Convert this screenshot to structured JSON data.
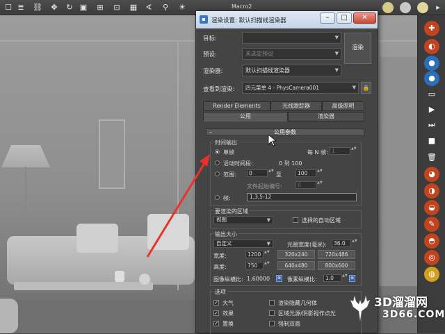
{
  "toolbar": {
    "macro_label": "Macro2"
  },
  "dialog": {
    "title": "渲染设置: 默认扫描线渲染器",
    "target_label": "目标:",
    "target_value": "",
    "preset_label": "预设:",
    "preset_value": "未选定预设",
    "renderer_label": "渲染器:",
    "renderer_value": "默认扫描线渲染器",
    "view_label": "查看到渲染:",
    "view_value": "四元菜单 4 - PhysCamera001",
    "render_button": "渲染",
    "tabs_top": [
      "Render Elements",
      "光线跟踪器",
      "高级照明"
    ],
    "tabs_bottom": [
      "公用",
      "渲染器"
    ],
    "rollout_title": "公用参数",
    "time_output": {
      "title": "时间输出",
      "single": "单帧",
      "every_n_label": "每 N 帧:",
      "every_n_value": "1",
      "active_segment": "活动时间段:",
      "active_range": "0 到 100",
      "range_label": "范围:",
      "range_from": "0",
      "range_to_label": "至",
      "range_to": "100",
      "file_start_label": "文件起始编号:",
      "file_start_value": "0",
      "frames_label": "帧:",
      "frames_value": "1,3,5-12"
    },
    "render_area": {
      "title": "要渲染的区域",
      "value": "视图",
      "auto_region_label": "选择的自动区域"
    },
    "output_size": {
      "title": "输出大小",
      "preset": "自定义",
      "aperture_label": "光圈宽度(毫米):",
      "aperture_value": "36.0",
      "width_label": "宽度:",
      "width_value": "1200",
      "height_label": "高度:",
      "height_value": "750",
      "presets": [
        "320x240",
        "720x486",
        "640x480",
        "800x600"
      ],
      "image_aspect_label": "图像纵横比:",
      "image_aspect_value": "1.60000",
      "pixel_aspect_label": "像素纵横比:",
      "pixel_aspect_value": "1.0"
    },
    "options": {
      "title": "选项",
      "items_left": [
        "大气",
        "效果",
        "置换"
      ],
      "items_right": [
        "渲染隐藏几何体",
        "区域光源/阴影视作点光",
        "强制双面"
      ]
    }
  },
  "watermark": {
    "main": "3D溜溜网",
    "sub": "3D66.COM"
  },
  "colors": {
    "accent": "#e8322a",
    "titlebar": "#d2deee",
    "close": "#c94a35"
  }
}
